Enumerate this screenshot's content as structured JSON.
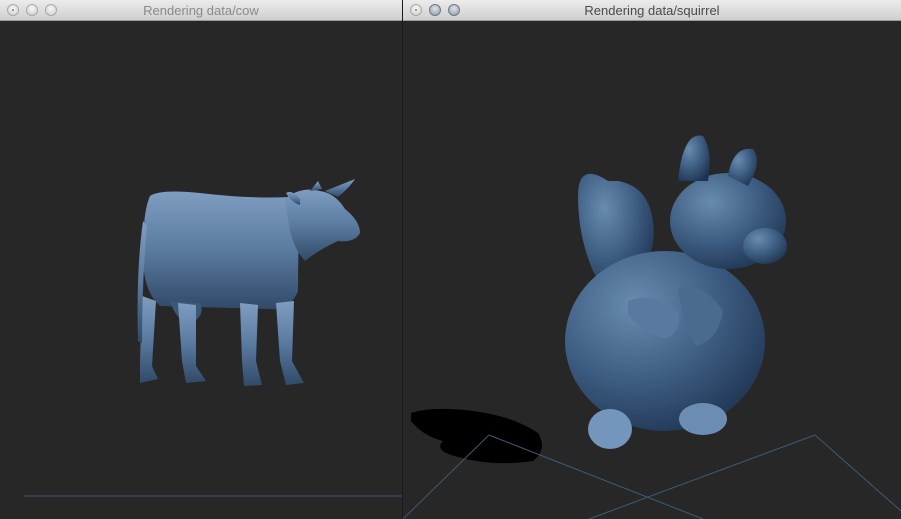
{
  "windows": {
    "cow": {
      "title": "Rendering data/cow"
    },
    "squirrel": {
      "title": "Rendering data/squirrel"
    }
  },
  "colors": {
    "model": "#4f6f93",
    "background": "#282828",
    "grid": "#4a6a8a"
  },
  "icons": [
    "close-icon",
    "minimize-icon",
    "zoom-icon"
  ]
}
